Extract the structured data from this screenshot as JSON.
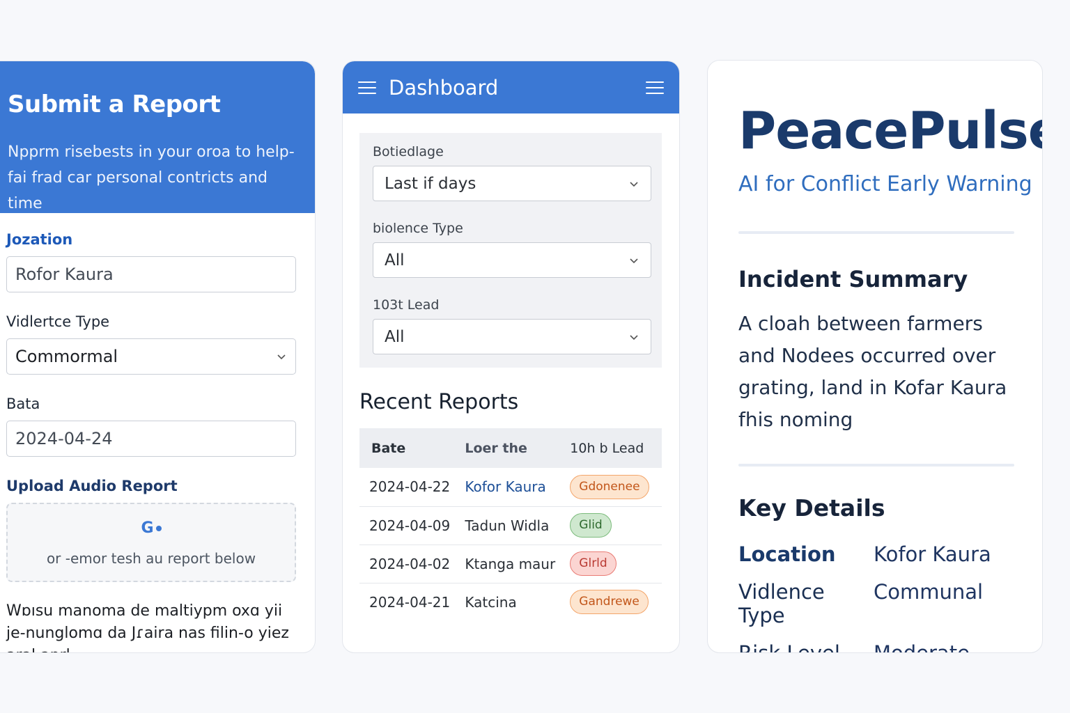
{
  "submit_panel": {
    "title": "Submit a Report",
    "description": "Npprm risebests in your oroa to help-fai frad car personal contricts and time",
    "location_label": "Jozation",
    "location_value": "Rofor Kaura",
    "violence_type_label": "Vidlertce Type",
    "violence_type_value": "Commormal",
    "date_label": "Bata",
    "date_value": "2024-04-24",
    "upload_label": "Upload Audio Report",
    "upload_icon_text": "G",
    "upload_hint": "or -emor tesh au report below",
    "note": "Wɒısu manoma de maltiypm oxɑ yii je-nunglomɑ da Jɾaira nas filin-o yiez aral anrl"
  },
  "dashboard_panel": {
    "title": "Dashboard",
    "filters": [
      {
        "label": "Botiedlage",
        "value": "Last if days"
      },
      {
        "label": "biolence Type",
        "value": "All"
      },
      {
        "label": "103t Lead",
        "value": "All"
      }
    ],
    "recent_title": "Recent Reports",
    "table_headers": [
      "Bate",
      "Loer the",
      "10h b Lead"
    ],
    "rows": [
      {
        "date": "2024-04-22",
        "location": "Kofor Kaura",
        "badge": "Gdonenee",
        "badge_color": "orange"
      },
      {
        "date": "2024-04-09",
        "location": "Tadun Widla",
        "badge": "Glid",
        "badge_color": "green"
      },
      {
        "date": "2024-04-02",
        "location": "Ktanga maur",
        "badge": "Glrld",
        "badge_color": "red"
      },
      {
        "date": "2024-04-21",
        "location": "Katcina",
        "badge": "Gandrewe",
        "badge_color": "orange"
      }
    ]
  },
  "info_panel": {
    "brand": "PeacePulse",
    "tagline": "AI for Conflict Early Warning",
    "summary_title": "Incident Summary",
    "summary_text": "A cloah between farmers and Nodees occurred over grating, land in Kofar Kaura fhis noming",
    "details_title": "Key Details",
    "details": [
      {
        "key": "Location",
        "value": "Kofor Kaura"
      },
      {
        "key": "Vidlence Type",
        "value": "Communal"
      },
      {
        "key": "Risk Level",
        "value": "Moderate"
      }
    ]
  },
  "colors": {
    "primary": "#3b78d4",
    "navy": "#1a3a6b",
    "background": "#f7f8fb"
  }
}
